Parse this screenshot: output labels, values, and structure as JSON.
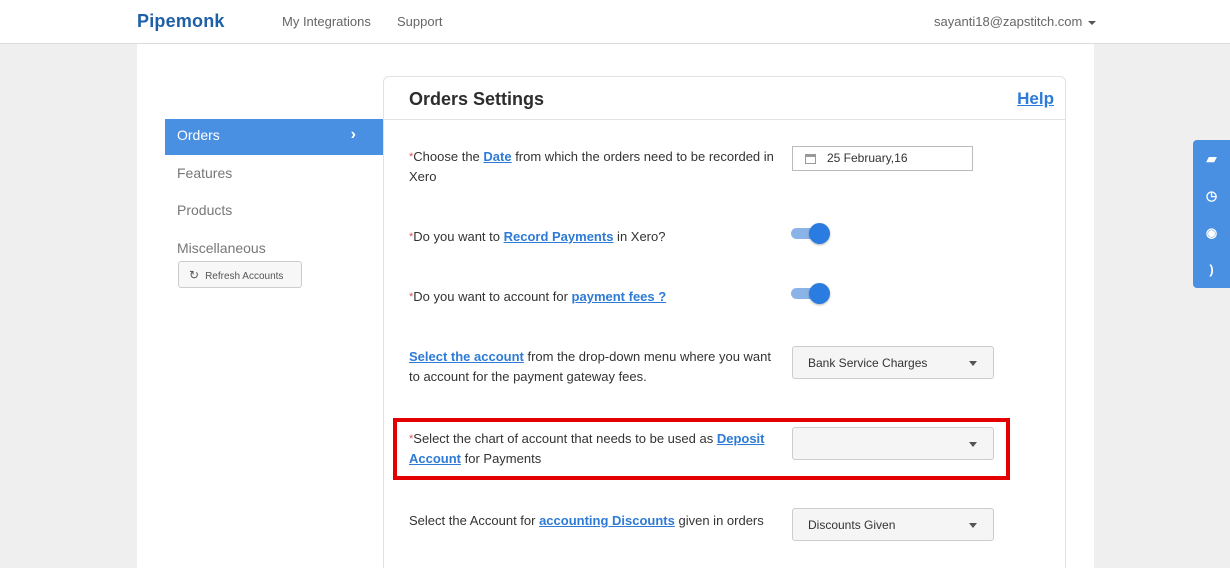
{
  "header": {
    "brand": "Pipemonk",
    "nav": [
      "My Integrations",
      "Support"
    ],
    "user_email": "sayanti18@zapstitch.com"
  },
  "sidebar": {
    "items": [
      {
        "label": "Orders",
        "active": true
      },
      {
        "label": "Features"
      },
      {
        "label": "Products"
      },
      {
        "label": "Miscellaneous"
      }
    ],
    "refresh_label": "Refresh Accounts"
  },
  "panel": {
    "title": "Orders Settings",
    "help": "Help"
  },
  "questions": {
    "q1": {
      "req": "*",
      "pre": "Choose the ",
      "link": "Date",
      "post": " from which the orders need to be recorded in Xero"
    },
    "q2": {
      "req": "*",
      "pre": "Do you want to ",
      "link": "Record Payments",
      "post": " in Xero?"
    },
    "q3": {
      "req": "*",
      "pre": "Do you want to account for ",
      "link": "payment fees ?",
      "post": ""
    },
    "q4": {
      "link": "Select the account",
      "post": " from the drop-down menu where you want to account for the payment gateway fees."
    },
    "q5": {
      "req": "*",
      "pre": "Select the chart of account that needs to be used as ",
      "link": "Deposit Account",
      "post": " for Payments"
    },
    "q6": {
      "pre": "Select the Account for ",
      "link": "accounting Discounts",
      "post": " given in orders"
    }
  },
  "controls": {
    "date_value": "25 February,16",
    "record_payments_on": true,
    "payment_fees_on": true,
    "fees_account": "Bank Service Charges",
    "deposit_account": "",
    "discounts_account": "Discounts Given"
  },
  "floating_icons": [
    "book-icon",
    "clock-icon",
    "lifebuoy-icon",
    "rss-icon"
  ],
  "colors": {
    "brand": "#1e5fa8",
    "accent": "#4a90e2",
    "link": "#2d7bd6",
    "highlight": "#e40000",
    "required": "#d9534f"
  }
}
